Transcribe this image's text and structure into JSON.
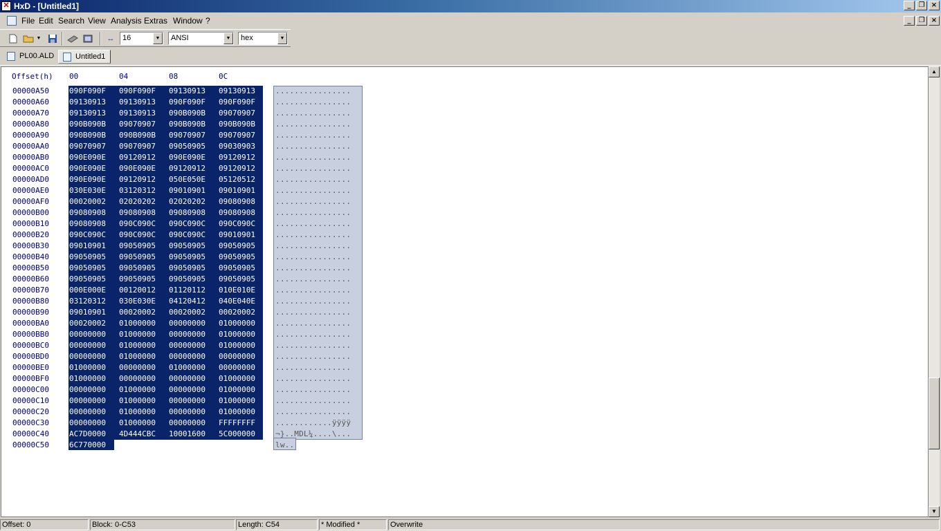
{
  "window": {
    "title": "HxD - [Untitled1]"
  },
  "menu": [
    "File",
    "Edit",
    "Search",
    "View",
    "Analysis",
    "Extras",
    "Window",
    "?"
  ],
  "toolbar": {
    "bytes_per_row": "16",
    "charset": "ANSI",
    "offset_base": "hex"
  },
  "tabs": [
    {
      "label": "PL00.ALD",
      "active": false
    },
    {
      "label": "Untitled1",
      "active": true
    }
  ],
  "hex_header": {
    "offset_label": "Offset(h)",
    "columns": [
      "00",
      "04",
      "08",
      "0C"
    ]
  },
  "rows": [
    {
      "offset": "00000A50",
      "hex": [
        "090F090F",
        "090F090F",
        "09130913",
        "09130913"
      ],
      "ascii": "................"
    },
    {
      "offset": "00000A60",
      "hex": [
        "09130913",
        "09130913",
        "090F090F",
        "090F090F"
      ],
      "ascii": "................"
    },
    {
      "offset": "00000A70",
      "hex": [
        "09130913",
        "09130913",
        "090B090B",
        "09070907"
      ],
      "ascii": "................"
    },
    {
      "offset": "00000A80",
      "hex": [
        "090B090B",
        "09070907",
        "090B090B",
        "090B090B"
      ],
      "ascii": "................"
    },
    {
      "offset": "00000A90",
      "hex": [
        "090B090B",
        "090B090B",
        "09070907",
        "09070907"
      ],
      "ascii": "................"
    },
    {
      "offset": "00000AA0",
      "hex": [
        "09070907",
        "09070907",
        "09050905",
        "09030903"
      ],
      "ascii": "................"
    },
    {
      "offset": "00000AB0",
      "hex": [
        "090E090E",
        "09120912",
        "090E090E",
        "09120912"
      ],
      "ascii": "................"
    },
    {
      "offset": "00000AC0",
      "hex": [
        "090E090E",
        "090E090E",
        "09120912",
        "09120912"
      ],
      "ascii": "................"
    },
    {
      "offset": "00000AD0",
      "hex": [
        "090E090E",
        "09120912",
        "050E050E",
        "05120512"
      ],
      "ascii": "................"
    },
    {
      "offset": "00000AE0",
      "hex": [
        "030E030E",
        "03120312",
        "09010901",
        "09010901"
      ],
      "ascii": "................"
    },
    {
      "offset": "00000AF0",
      "hex": [
        "00020002",
        "02020202",
        "02020202",
        "09080908"
      ],
      "ascii": "................"
    },
    {
      "offset": "00000B00",
      "hex": [
        "09080908",
        "09080908",
        "09080908",
        "09080908"
      ],
      "ascii": "................"
    },
    {
      "offset": "00000B10",
      "hex": [
        "09080908",
        "090C090C",
        "090C090C",
        "090C090C"
      ],
      "ascii": "................"
    },
    {
      "offset": "00000B20",
      "hex": [
        "090C090C",
        "090C090C",
        "090C090C",
        "09010901"
      ],
      "ascii": "................"
    },
    {
      "offset": "00000B30",
      "hex": [
        "09010901",
        "09050905",
        "09050905",
        "09050905"
      ],
      "ascii": "................"
    },
    {
      "offset": "00000B40",
      "hex": [
        "09050905",
        "09050905",
        "09050905",
        "09050905"
      ],
      "ascii": "................"
    },
    {
      "offset": "00000B50",
      "hex": [
        "09050905",
        "09050905",
        "09050905",
        "09050905"
      ],
      "ascii": "................"
    },
    {
      "offset": "00000B60",
      "hex": [
        "09050905",
        "09050905",
        "09050905",
        "09050905"
      ],
      "ascii": "................"
    },
    {
      "offset": "00000B70",
      "hex": [
        "000E000E",
        "00120012",
        "01120112",
        "010E010E"
      ],
      "ascii": "................"
    },
    {
      "offset": "00000B80",
      "hex": [
        "03120312",
        "030E030E",
        "04120412",
        "040E040E"
      ],
      "ascii": "................"
    },
    {
      "offset": "00000B90",
      "hex": [
        "09010901",
        "00020002",
        "00020002",
        "00020002"
      ],
      "ascii": "................"
    },
    {
      "offset": "00000BA0",
      "hex": [
        "00020002",
        "01000000",
        "00000000",
        "01000000"
      ],
      "ascii": "................"
    },
    {
      "offset": "00000BB0",
      "hex": [
        "00000000",
        "01000000",
        "00000000",
        "01000000"
      ],
      "ascii": "................"
    },
    {
      "offset": "00000BC0",
      "hex": [
        "00000000",
        "01000000",
        "00000000",
        "01000000"
      ],
      "ascii": "................"
    },
    {
      "offset": "00000BD0",
      "hex": [
        "00000000",
        "01000000",
        "00000000",
        "00000000"
      ],
      "ascii": "................"
    },
    {
      "offset": "00000BE0",
      "hex": [
        "01000000",
        "00000000",
        "01000000",
        "00000000"
      ],
      "ascii": "................"
    },
    {
      "offset": "00000BF0",
      "hex": [
        "01000000",
        "00000000",
        "00000000",
        "01000000"
      ],
      "ascii": "................"
    },
    {
      "offset": "00000C00",
      "hex": [
        "00000000",
        "01000000",
        "00000000",
        "01000000"
      ],
      "ascii": "................"
    },
    {
      "offset": "00000C10",
      "hex": [
        "00000000",
        "01000000",
        "00000000",
        "01000000"
      ],
      "ascii": "................"
    },
    {
      "offset": "00000C20",
      "hex": [
        "00000000",
        "01000000",
        "00000000",
        "01000000"
      ],
      "ascii": "................"
    },
    {
      "offset": "00000C30",
      "hex": [
        "00000000",
        "01000000",
        "00000000",
        "FFFFFFFF"
      ],
      "ascii": "............ÿÿÿÿ"
    },
    {
      "offset": "00000C40",
      "hex": [
        "AC7D0000",
        "4D444CBC",
        "10001600",
        "5C000000"
      ],
      "ascii": "¬}..MDL¼....\\..."
    },
    {
      "offset": "00000C50",
      "hex": [
        "6C770000"
      ],
      "ascii": "lw.."
    }
  ],
  "status": {
    "offset": "Offset: 0",
    "block": "Block: 0-C53",
    "length": "Length: C54",
    "modified": "* Modified *",
    "mode": "Overwrite"
  }
}
